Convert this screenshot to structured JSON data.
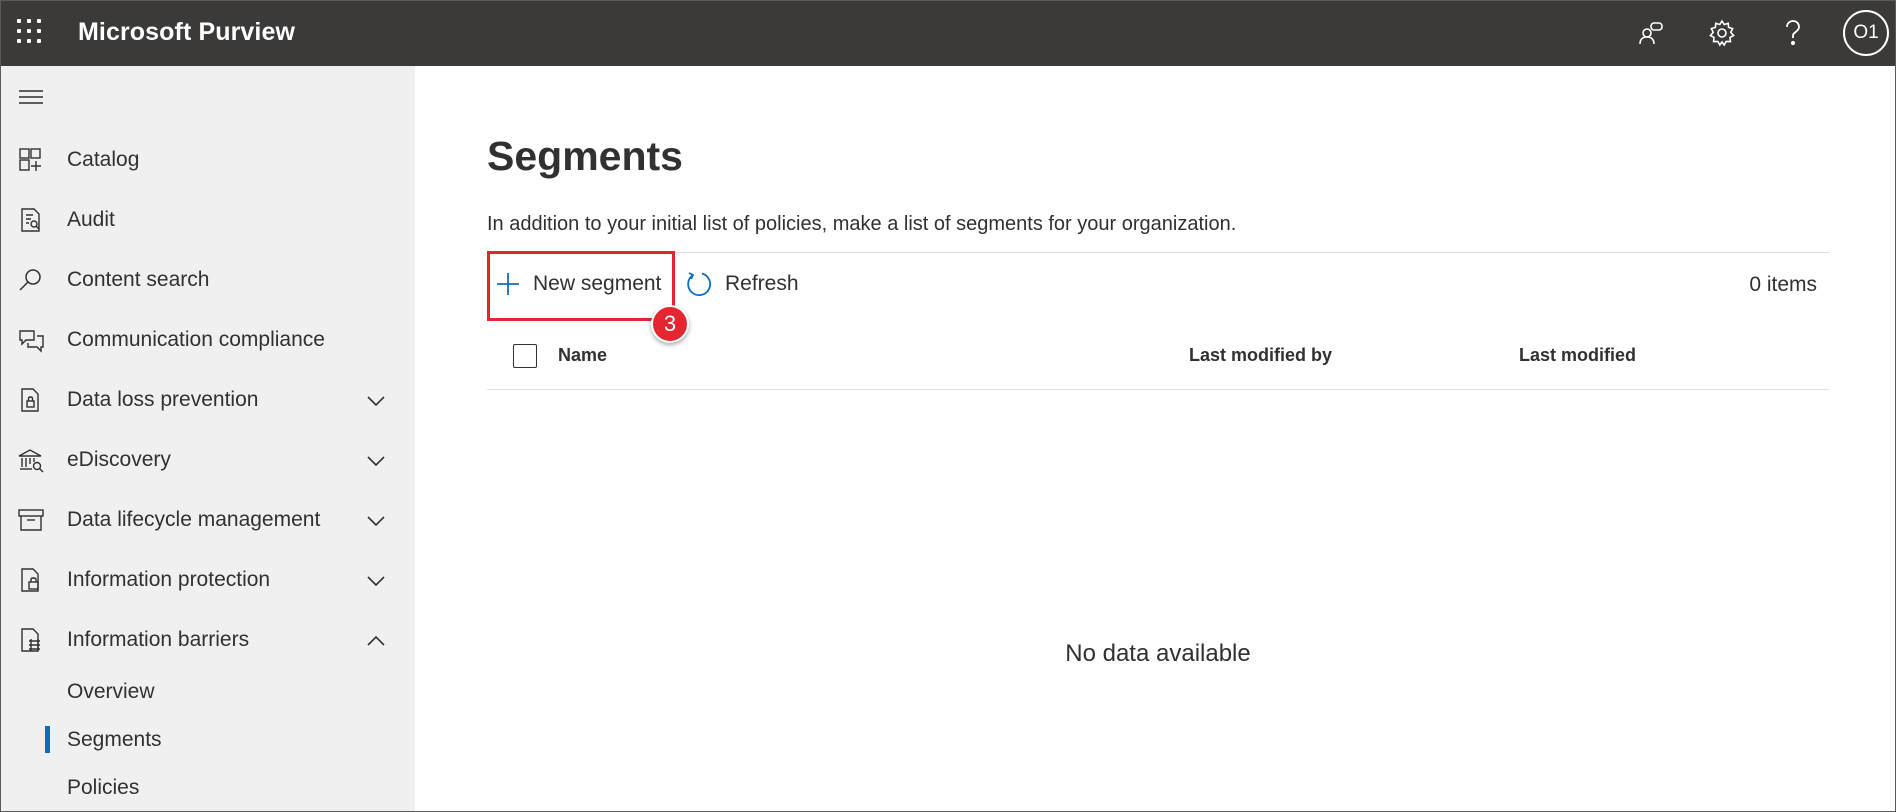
{
  "app": {
    "title": "Microsoft Purview",
    "avatar_initials": "O1"
  },
  "header_icons": [
    "community-icon",
    "gear-icon",
    "help-icon"
  ],
  "sidebar": {
    "items": [
      {
        "label": "Catalog",
        "icon": "catalog-icon"
      },
      {
        "label": "Audit",
        "icon": "audit-icon"
      },
      {
        "label": "Content search",
        "icon": "search-icon"
      },
      {
        "label": "Communication compliance",
        "icon": "chat-icon"
      },
      {
        "label": "Data loss prevention",
        "icon": "dlp-icon",
        "chevron": "down"
      },
      {
        "label": "eDiscovery",
        "icon": "bank-icon",
        "chevron": "down"
      },
      {
        "label": "Data lifecycle management",
        "icon": "archive-icon",
        "chevron": "down"
      },
      {
        "label": "Information protection",
        "icon": "lock-doc-icon",
        "chevron": "down"
      },
      {
        "label": "Information barriers",
        "icon": "barrier-icon",
        "chevron": "up"
      }
    ],
    "subitems": [
      {
        "label": "Overview",
        "selected": false
      },
      {
        "label": "Segments",
        "selected": true
      },
      {
        "label": "Policies",
        "selected": false
      }
    ]
  },
  "main": {
    "title": "Segments",
    "description": "In addition to your initial list of policies, make a list of segments for your organization.",
    "commands": {
      "new_label": "New segment",
      "refresh_label": "Refresh"
    },
    "item_count": "0 items",
    "step_badge": "3",
    "columns": [
      "Name",
      "Last modified by",
      "Last modified"
    ],
    "empty_text": "No data available"
  },
  "colors": {
    "topbar": "#3b3a39",
    "sidebar": "#f0f0f0",
    "accent": "#0f6cbd",
    "highlight": "#e3262f"
  }
}
